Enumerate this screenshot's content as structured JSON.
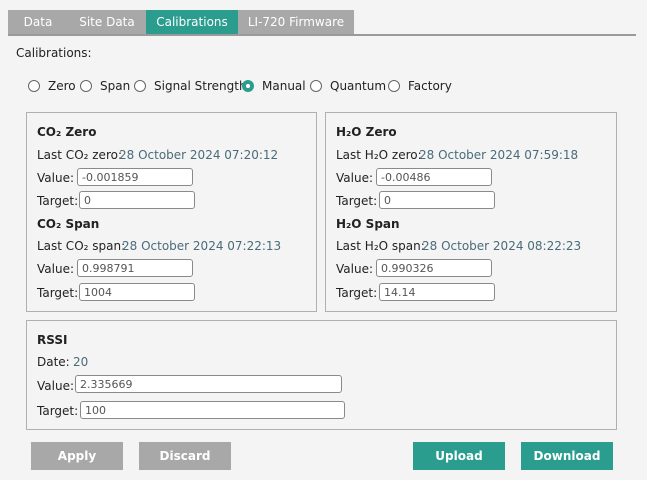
{
  "tabs": [
    {
      "label": "Data",
      "active": false
    },
    {
      "label": "Site Data",
      "active": false
    },
    {
      "label": "Calibrations",
      "active": true
    },
    {
      "label": "LI-720 Firmware",
      "active": false
    }
  ],
  "section_label": "Calibrations:",
  "radios": [
    {
      "label": "Zero",
      "selected": false
    },
    {
      "label": "Span",
      "selected": false
    },
    {
      "label": "Signal Strength",
      "selected": false
    },
    {
      "label": "Manual",
      "selected": true
    },
    {
      "label": "Quantum",
      "selected": false
    },
    {
      "label": "Factory",
      "selected": false
    }
  ],
  "co2": {
    "zero_heading": "CO₂ Zero",
    "last_zero_label": "Last CO₂ zero:",
    "last_zero_value": "28 October 2024 07:20:12",
    "value_label": "Value:",
    "zero_value": "-0.001859",
    "target_label": "Target:",
    "zero_target": "0",
    "span_heading": "CO₂ Span",
    "last_span_label": "Last CO₂ span:",
    "last_span_value": "28 October 2024 07:22:13",
    "span_value": "0.998791",
    "span_target": "1004"
  },
  "h2o": {
    "zero_heading": "H₂O Zero",
    "last_zero_label": "Last H₂O zero:",
    "last_zero_value": "28 October 2024 07:59:18",
    "value_label": "Value:",
    "zero_value": "-0.00486",
    "target_label": "Target:",
    "zero_target": "0",
    "span_heading": "H₂O Span",
    "last_span_label": "Last H₂O span:",
    "last_span_value": "28 October 2024 08:22:23",
    "span_value": "0.990326",
    "span_target": "14.14"
  },
  "rssi": {
    "heading": "RSSI",
    "date_label": "Date:",
    "date_value": "20",
    "value_label": "Value:",
    "value": "2.335669",
    "target_label": "Target:",
    "target": "100"
  },
  "buttons": {
    "apply": "Apply",
    "discard": "Discard",
    "upload": "Upload",
    "download": "Download"
  },
  "colors": {
    "accent": "#2a9d8f",
    "inactive": "#a8a8a8",
    "value_text": "#4a6b7a"
  }
}
